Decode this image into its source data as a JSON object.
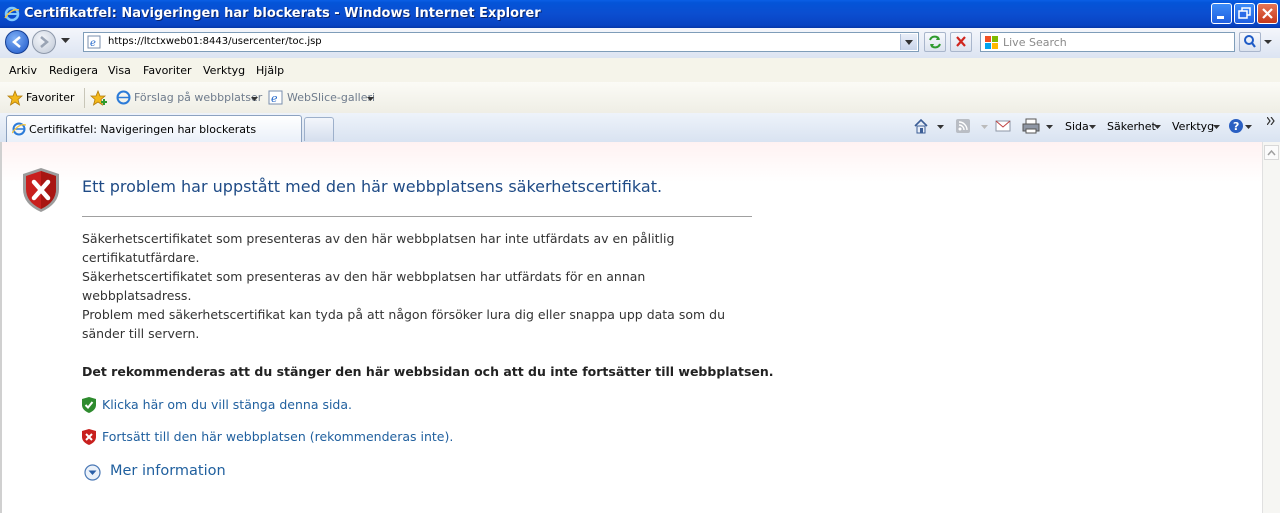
{
  "window": {
    "title": "Certifikatfel: Navigeringen har blockerats - Windows Internet Explorer"
  },
  "address": {
    "url": "https://ltctxweb01:8443/usercenter/toc.jsp",
    "search_placeholder": "Live Search"
  },
  "menu": [
    "Arkiv",
    "Redigera",
    "Visa",
    "Favoriter",
    "Verktyg",
    "Hjälp"
  ],
  "favorites": {
    "favorites_label": "Favoriter",
    "suggested_sites": "Förslag på webbplatser",
    "webslice": "WebSlice-galleri"
  },
  "tabs": {
    "active_label": "Certifikatfel: Navigeringen har blockerats"
  },
  "commandbar": {
    "page": "Sida",
    "safety": "Säkerhet",
    "tools": "Verktyg"
  },
  "page": {
    "headline": "Ett problem har uppstått med den här webbplatsens säkerhetscertifikat.",
    "para1": "Säkerhetscertifikatet som presenteras av den här webbplatsen har inte utfärdats av en pålitlig certifikatutfärdare.",
    "para2": "Säkerhetscertifikatet som presenteras av den här webbplatsen har utfärdats för en annan webbplatsadress.",
    "para3": "Problem med säkerhetscertifikat kan tyda på att någon försöker lura dig eller snappa upp data som du sänder till servern.",
    "recommendation": "Det rekommenderas att du stänger den här webbsidan och att du inte fortsätter till webbplatsen.",
    "close_link": "Klicka här om du vill stänga denna sida.",
    "continue_link": "Fortsätt till den här webbplatsen (rekommenderas inte).",
    "more_info": "Mer information"
  },
  "colors": {
    "titlebar": "#0B4ED0",
    "headline": "#1F4B86",
    "link": "#1F5F9E",
    "error_red": "#C8201E",
    "ok_green": "#2E8B2E"
  }
}
